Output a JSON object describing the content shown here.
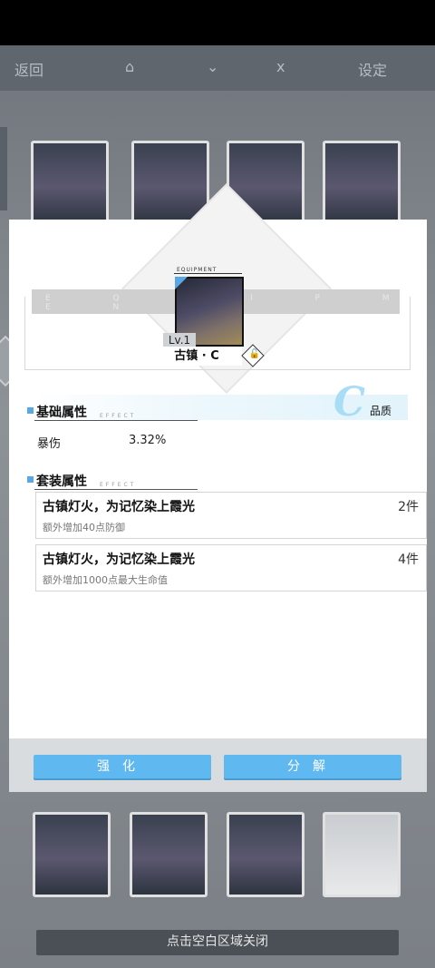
{
  "background": {
    "nav_labels": [
      "返回",
      "⌂",
      "⌄",
      "ⅹ",
      "设定"
    ]
  },
  "modal": {
    "equipment_label": "EQUIPMENT",
    "band_text": "E Q U I P M E N T",
    "level": "Lv.1",
    "item_name": "古镇 · C",
    "lock_icon": "lock-icon",
    "quality": {
      "letter": "C",
      "label": "品质"
    },
    "basic_section": {
      "title": "基础属性",
      "subtitle": "EFFECT",
      "attrs": [
        {
          "name": "暴伤",
          "value": "3.32%"
        }
      ]
    },
    "set_section": {
      "title": "套装属性",
      "subtitle": "EFFECT",
      "items": [
        {
          "title": "古镇灯火，为记忆染上霞光",
          "count": "2件",
          "desc": "额外增加40点防御"
        },
        {
          "title": "古镇灯火，为记忆染上霞光",
          "count": "4件",
          "desc": "额外增加1000点最大生命值"
        }
      ]
    },
    "buttons": {
      "enhance": "强化",
      "decompose": "分解"
    }
  },
  "close_hint": "点击空白区域关闭",
  "colors": {
    "accent": "#5fb8f0",
    "quality": "#a9dcf5"
  }
}
